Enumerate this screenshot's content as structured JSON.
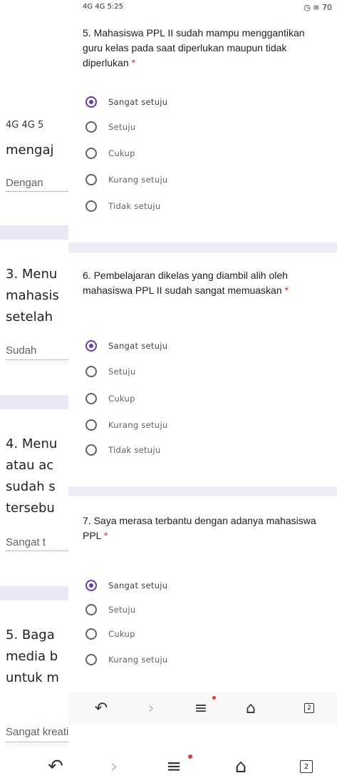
{
  "colors": {
    "accent": "#673ab7",
    "required": "#d93025",
    "notification_dot": "#e53935"
  },
  "background_screen": {
    "status": "4G 4G 5",
    "snippets": [
      {
        "text": "mengaj"
      },
      {
        "text": "Dengan"
      },
      {
        "text": "3. Menu"
      },
      {
        "text": "mahasis"
      },
      {
        "text": "setelah"
      },
      {
        "text": "Sudah"
      },
      {
        "text": "4. Menu"
      },
      {
        "text": "atau ac"
      },
      {
        "text": "sudah s"
      },
      {
        "text": "tersebu"
      },
      {
        "text": "Sangat t"
      },
      {
        "text": "5. Baga"
      },
      {
        "text": "media b"
      },
      {
        "text": "untuk m"
      }
    ],
    "last_answer": "Sangat kreatif sekali"
  },
  "overlay_screen": {
    "status": {
      "left": "4G 4G 5:25",
      "right": "◷ ≋ 70"
    },
    "questions": [
      {
        "title": "5. Mahasiswa PPL II sudah mampu menggantikan guru kelas pada saat diperlukan maupun tidak diperlukan",
        "required": "*",
        "options": [
          "Sangat setuju",
          "Setuju",
          "Cukup",
          "Kurang setuju",
          "Tidak setuju"
        ],
        "selected": "Sangat setuju"
      },
      {
        "title": "6. Pembelajaran dikelas yang diambil alih oleh mahasiswa PPL II sudah sangat memuaskan",
        "required": "*",
        "options": [
          "Sangat setuju",
          "Setuju",
          "Cukup",
          "Kurang setuju",
          "Tidak setuju"
        ],
        "selected": "Sangat setuju"
      },
      {
        "title": "7. Saya merasa terbantu dengan adanya mahasiswa PPL",
        "required": "*",
        "options": [
          "Sangat setuju",
          "Setuju",
          "Cukup",
          "Kurang setuju"
        ],
        "selected": "Sangat setuju"
      }
    ],
    "nav": {
      "back": "↶",
      "forward": "›",
      "menu": "≡",
      "home": "⌂",
      "tabs": "2"
    }
  },
  "outer_nav": {
    "back": "↶",
    "forward": "›",
    "menu": "≡",
    "home": "⌂",
    "tabs": "2"
  }
}
